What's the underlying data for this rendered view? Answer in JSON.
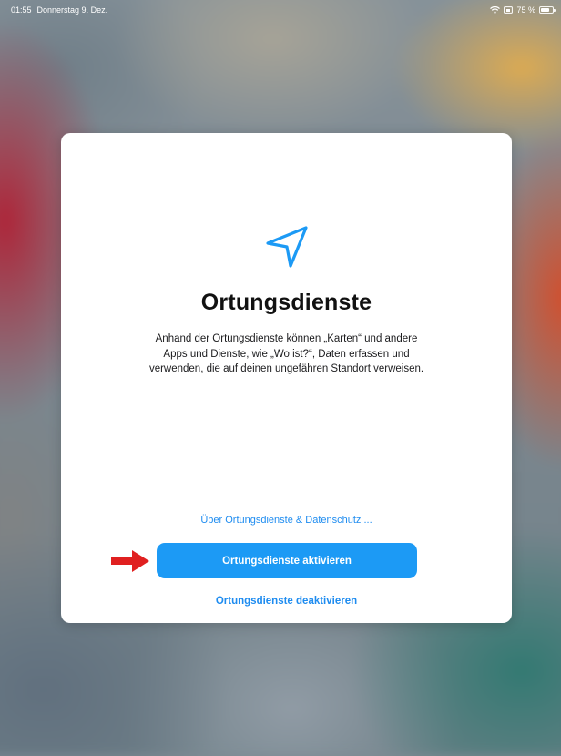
{
  "status_bar": {
    "time": "01:55",
    "date": "Donnerstag 9. Dez.",
    "battery": "75 %",
    "battery_level": 0.75,
    "icons": [
      "wifi-icon",
      "orientation-lock-icon",
      "battery-icon"
    ]
  },
  "dialog": {
    "icon": "location-arrow-icon",
    "title": "Ortungsdienste",
    "description": "Anhand der Ortungsdienste können „Karten“ und andere\nApps und Dienste, wie „Wo ist?“, Daten erfassen und\nverwenden, die auf deinen ungefähren Standort verweisen.",
    "privacy_link": "Über Ortungsdienste & Datenschutz ...",
    "primary_button": "Ortungsdienste aktivieren",
    "secondary_button": "Ortungsdienste deaktivieren"
  },
  "annotation": {
    "icon": "red-arrow-icon"
  },
  "colors": {
    "accent": "#1c9af5",
    "link": "#1e8cf0",
    "annotation_arrow": "#e02020"
  }
}
